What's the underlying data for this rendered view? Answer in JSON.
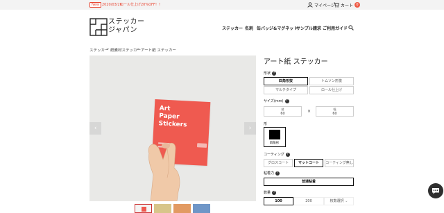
{
  "announcement": {
    "badge": "New",
    "date": "2020/03/26",
    "text": "ロール仕上げ20%OFF！！"
  },
  "utility": {
    "mypage_label": "マイページ",
    "cart_label": "カート",
    "cart_count": "0"
  },
  "brand": {
    "logo_line1": "ステッカー",
    "logo_line2": "ジャパン"
  },
  "nav": {
    "items": [
      "ステッカー",
      "名刺",
      "缶バッジ&マグネット",
      "サンプル請求",
      "ご利用ガイド"
    ]
  },
  "breadcrumb": {
    "items": [
      "ステッカー",
      "紙素材ステッカー",
      "アート紙 ステッカー"
    ],
    "separator": ">"
  },
  "gallery": {
    "card_text": "Art\nPaper\nStickers",
    "prev_label": "‹",
    "next_label": "›",
    "thumbnail_count": 4
  },
  "product": {
    "title": "アート紙 ステッカー",
    "shape_section": {
      "label": "形状",
      "options": [
        "四角形抜",
        "トムソン形抜",
        "マルチタイプ",
        "ロール仕上げ"
      ],
      "selected_index": 0
    },
    "size_section": {
      "label": "サイズ(mm)",
      "height_label": "縦",
      "height_value": "60",
      "width_label": "幅",
      "width_value": "60",
      "times": "×"
    },
    "form_section": {
      "label": "形",
      "selected": "四角形"
    },
    "coating_section": {
      "label": "コーティング",
      "options": [
        "グロスコート",
        "マットコート",
        "コーティング無し"
      ],
      "selected_index": 1
    },
    "adhesive_section": {
      "label": "粘着力",
      "options": [
        "普通粘着"
      ],
      "selected_index": 0
    },
    "quantity_section": {
      "label": "数量",
      "options": [
        "100",
        "200",
        "枚数選択"
      ],
      "selected_index": 0
    }
  },
  "colors": {
    "accent_red": "#e8432f",
    "card_red": "#ef5a50",
    "cart_badge": "#ef5a45"
  }
}
